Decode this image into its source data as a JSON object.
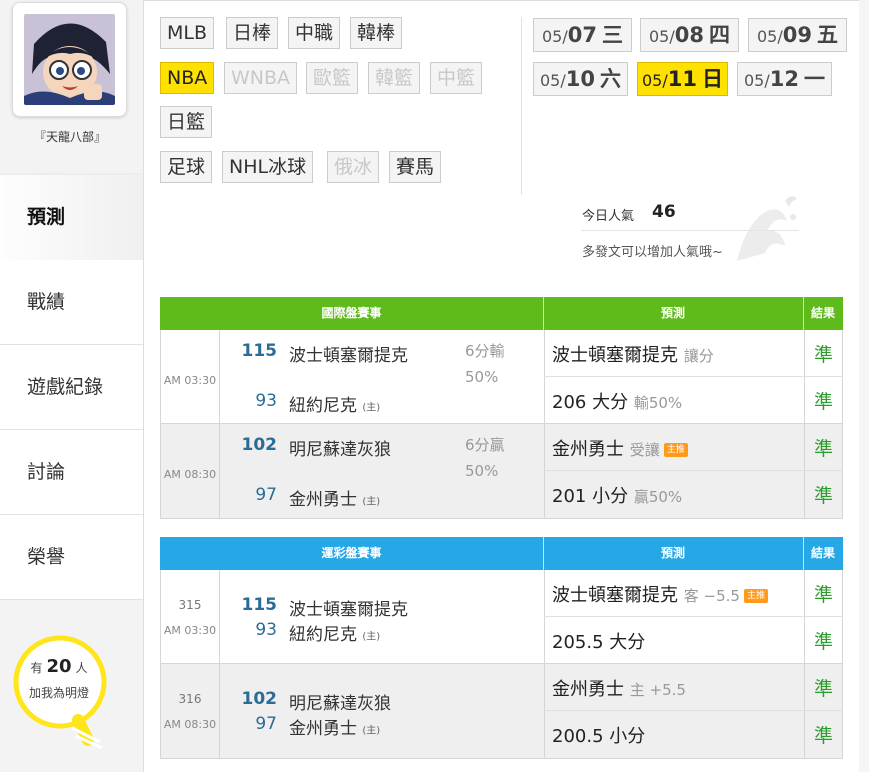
{
  "sidebar": {
    "username": "『天龍八部』",
    "nav": [
      {
        "label": "預測",
        "active": true
      },
      {
        "label": "戰績"
      },
      {
        "label": "遊戲紀錄"
      },
      {
        "label": "討論"
      },
      {
        "label": "榮譽"
      }
    ],
    "bulb": {
      "prefix": "有",
      "count": "20",
      "suffix": "人",
      "line2": "加我為明燈"
    }
  },
  "leagues": [
    {
      "label": "MLB",
      "state": "normal"
    },
    {
      "label": "日棒",
      "state": "normal"
    },
    {
      "label": "中職",
      "state": "normal"
    },
    {
      "label": "韓棒",
      "state": "normal"
    },
    {
      "label": "NBA",
      "state": "active"
    },
    {
      "label": "WNBA",
      "state": "disabled"
    },
    {
      "label": "歐籃",
      "state": "disabled"
    },
    {
      "label": "韓籃",
      "state": "disabled"
    },
    {
      "label": "中籃",
      "state": "disabled"
    },
    {
      "label": "日籃",
      "state": "normal"
    },
    {
      "label": "足球",
      "state": "normal"
    },
    {
      "label": "NHL冰球",
      "state": "normal"
    },
    {
      "label": "俄冰",
      "state": "disabled"
    },
    {
      "label": "賽馬",
      "state": "normal"
    }
  ],
  "dates": [
    {
      "month": "05/",
      "day": "07",
      "weekday": "三"
    },
    {
      "month": "05/",
      "day": "08",
      "weekday": "四"
    },
    {
      "month": "05/",
      "day": "09",
      "weekday": "五"
    },
    {
      "month": "05/",
      "day": "10",
      "weekday": "六"
    },
    {
      "month": "05/",
      "day": "11",
      "weekday": "日",
      "active": true
    },
    {
      "month": "05/",
      "day": "12",
      "weekday": "一"
    }
  ],
  "popularity": {
    "label": "今日人氣",
    "count": "46",
    "tip": "多發文可以增加人氣哦~"
  },
  "international": {
    "headers": {
      "match": "國際盤賽事",
      "prediction": "預測",
      "result": "結果"
    },
    "games": [
      {
        "time": "AM 03:30",
        "away": {
          "score": "115",
          "team": "波士頓塞爾提克",
          "winner": true
        },
        "home": {
          "score": "93",
          "team": "紐約尼克",
          "mark": "(主)"
        },
        "handicap": "6分輸50%",
        "predictions": [
          {
            "main": "波士頓塞爾提克",
            "sub": "讓分",
            "result": "準"
          },
          {
            "main": "206 大分",
            "sub": "輸50%",
            "result": "準"
          }
        ]
      },
      {
        "time": "AM 08:30",
        "away": {
          "score": "102",
          "team": "明尼蘇達灰狼",
          "winner": true
        },
        "home": {
          "score": "97",
          "team": "金州勇士",
          "mark": "(主)"
        },
        "handicap": "6分贏50%",
        "predictions": [
          {
            "main": "金州勇士",
            "sub": "受讓",
            "badge": "主推",
            "result": "準"
          },
          {
            "main": "201 小分",
            "sub": "贏50%",
            "result": "準"
          }
        ]
      }
    ]
  },
  "lottery": {
    "headers": {
      "match": "運彩盤賽事",
      "prediction": "預測",
      "result": "結果"
    },
    "games": [
      {
        "number": "315",
        "time": "AM 03:30",
        "away": {
          "score": "115",
          "team": "波士頓塞爾提克",
          "winner": true
        },
        "home": {
          "score": "93",
          "team": "紐約尼克",
          "mark": "(主)"
        },
        "predictions": [
          {
            "main": "波士頓塞爾提克",
            "sub": "客 −5.5",
            "badge": "主推",
            "result": "準"
          },
          {
            "main": "205.5 大分",
            "sub": "",
            "result": "準"
          }
        ]
      },
      {
        "number": "316",
        "time": "AM 08:30",
        "away": {
          "score": "102",
          "team": "明尼蘇達灰狼",
          "winner": true
        },
        "home": {
          "score": "97",
          "team": "金州勇士",
          "mark": "(主)"
        },
        "predictions": [
          {
            "main": "金州勇士",
            "sub": "主 +5.5",
            "result": "準"
          },
          {
            "main": "200.5 小分",
            "sub": "",
            "result": "準"
          }
        ]
      }
    ]
  },
  "colors": {
    "accent_yellow": "#ffe100",
    "intl_header": "#5fbb1c",
    "lottery_header": "#26a8e6",
    "result_green": "#2a9d2a",
    "score_blue": "#2a6c96"
  }
}
